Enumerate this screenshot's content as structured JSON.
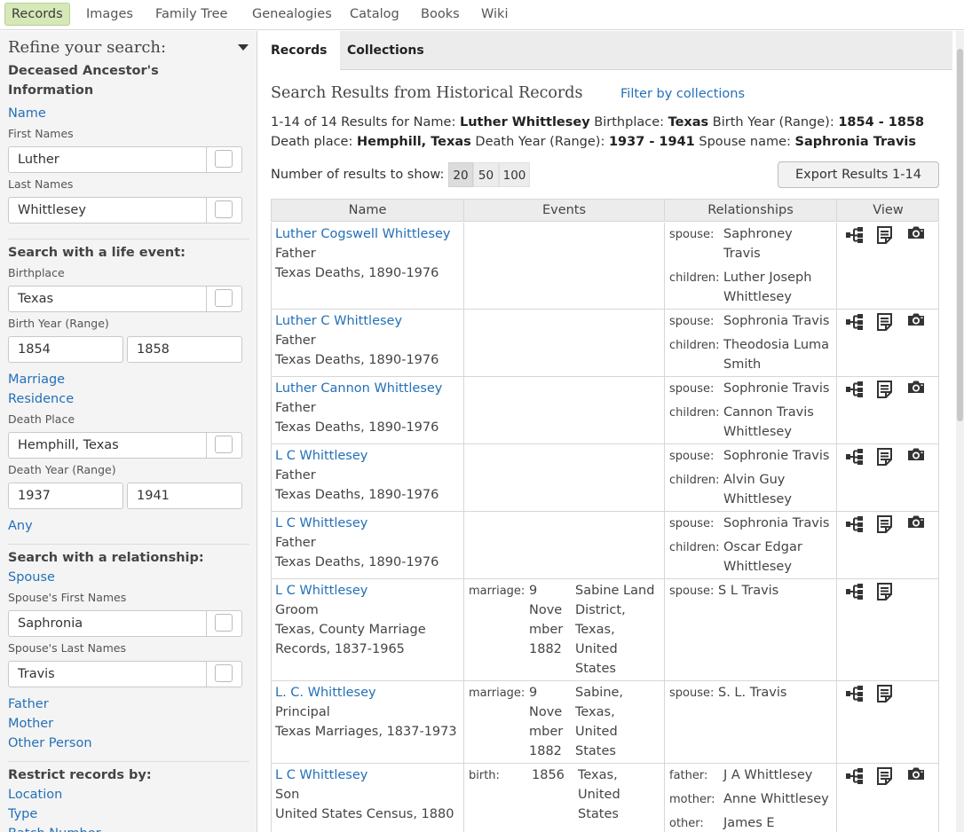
{
  "nav": [
    {
      "label": "Records",
      "active": true
    },
    {
      "label": "Images"
    },
    {
      "label": "Family Tree"
    },
    {
      "label": "Genealogies"
    },
    {
      "label": "Catalog"
    },
    {
      "label": "Books"
    },
    {
      "label": "Wiki"
    }
  ],
  "sidebar": {
    "title": "Refine your search:",
    "deceased_head_1": "Deceased Ancestor's",
    "deceased_head_2": "Information",
    "name_link": "Name",
    "first_names_label": "First Names",
    "first_names_value": "Luther",
    "last_names_label": "Last Names",
    "last_names_value": "Whittlesey",
    "life_event_head": "Search with a life event:",
    "birthplace_label": "Birthplace",
    "birthplace_value": "Texas",
    "birth_year_label": "Birth Year (Range)",
    "birth_year_from": "1854",
    "birth_year_to": "1858",
    "marriage_link": "Marriage",
    "residence_link": "Residence",
    "death_place_label": "Death Place",
    "death_place_value": "Hemphill, Texas",
    "death_year_label": "Death Year (Range)",
    "death_year_from": "1937",
    "death_year_to": "1941",
    "any_link": "Any",
    "relationship_head": "Search with a relationship:",
    "spouse_link": "Spouse",
    "spouse_first_label": "Spouse's First Names",
    "spouse_first_value": "Saphronia",
    "spouse_last_label": "Spouse's Last Names",
    "spouse_last_value": "Travis",
    "father_link": "Father",
    "mother_link": "Mother",
    "other_person_link": "Other Person",
    "restrict_head": "Restrict records by:",
    "location_link": "Location",
    "type_link": "Type",
    "batch_link": "Batch Number"
  },
  "tabs": [
    "Records",
    "Collections"
  ],
  "results": {
    "title": "Search Results from Historical Records",
    "filter_link": "Filter by collections",
    "summary_line1": [
      {
        "t": "1-14 of 14 Results for Name: "
      },
      {
        "t": "Luther Whittlesey",
        "b": true
      },
      {
        "t": " Birthplace: "
      },
      {
        "t": "Texas",
        "b": true
      },
      {
        "t": " Birth Year (Range): "
      },
      {
        "t": "1854 - 1858",
        "b": true
      }
    ],
    "summary_line2": [
      {
        "t": "Death place: "
      },
      {
        "t": "Hemphill, Texas",
        "b": true
      },
      {
        "t": " Death Year (Range): "
      },
      {
        "t": "1937 - 1941",
        "b": true
      },
      {
        "t": " Spouse name: "
      },
      {
        "t": "Saphronia Travis",
        "b": true
      }
    ],
    "show_label": "Number of results to show:",
    "show_options": [
      "20",
      "50",
      "100"
    ],
    "show_selected": "20",
    "export_label": "Export Results 1-14"
  },
  "table": {
    "headers": [
      "Name",
      "Events",
      "Relationships",
      "View"
    ],
    "rows": [
      {
        "name": "Luther Cogswell Whittlesey",
        "role": "Father",
        "collection": [
          "Texas Deaths, 1890-1976"
        ],
        "events": [],
        "rels": [
          {
            "label": "spouse:",
            "lines": [
              "Saphroney",
              "Travis"
            ]
          },
          {
            "label": "children:",
            "lines": [
              "Luther Joseph",
              "Whittlesey"
            ]
          }
        ],
        "camera": true
      },
      {
        "name": "Luther C Whittlesey",
        "role": "Father",
        "collection": [
          "Texas Deaths, 1890-1976"
        ],
        "events": [],
        "rels": [
          {
            "label": "spouse:",
            "lines": [
              "Sophronia Travis"
            ]
          },
          {
            "label": "children:",
            "lines": [
              "Theodosia Luma",
              "Smith"
            ]
          }
        ],
        "camera": true
      },
      {
        "name": "Luther Cannon Whittlesey",
        "role": "Father",
        "collection": [
          "Texas Deaths, 1890-1976"
        ],
        "events": [],
        "rels": [
          {
            "label": "spouse:",
            "lines": [
              "Sophronie Travis"
            ]
          },
          {
            "label": "children:",
            "lines": [
              "Cannon Travis",
              "Whittlesey"
            ]
          }
        ],
        "camera": true
      },
      {
        "name": "L C Whittlesey",
        "role": "Father",
        "collection": [
          "Texas Deaths, 1890-1976"
        ],
        "events": [],
        "rels": [
          {
            "label": "spouse:",
            "lines": [
              "Sophronie Travis"
            ]
          },
          {
            "label": "children:",
            "lines": [
              "Alvin Guy",
              "Whittlesey"
            ]
          }
        ],
        "camera": true
      },
      {
        "name": "L C Whittlesey",
        "role": "Father",
        "collection": [
          "Texas Deaths, 1890-1976"
        ],
        "events": [],
        "rels": [
          {
            "label": "spouse:",
            "lines": [
              "Sophronia Travis"
            ]
          },
          {
            "label": "children:",
            "lines": [
              "Oscar Edgar",
              "Whittlesey"
            ]
          }
        ],
        "camera": true
      },
      {
        "name": "L C Whittlesey",
        "role": "Groom",
        "collection": [
          "Texas, County Marriage",
          "Records, 1837-1965"
        ],
        "events": [
          {
            "label": "marriage:",
            "date": [
              "9",
              "Nove",
              "mber",
              "1882"
            ],
            "place": [
              "Sabine Land",
              "District,",
              "Texas,",
              "United",
              "States"
            ]
          }
        ],
        "rels": [
          {
            "label": "spouse:",
            "lines": [
              "S L Travis"
            ]
          }
        ],
        "camera": false
      },
      {
        "name": "L. C. Whittlesey",
        "role": "Principal",
        "collection": [
          "Texas Marriages, 1837-1973"
        ],
        "events": [
          {
            "label": "marriage:",
            "date": [
              "9",
              "Nove",
              "mber",
              "1882"
            ],
            "place": [
              "Sabine,",
              "Texas,",
              "United",
              "States"
            ]
          }
        ],
        "rels": [
          {
            "label": "spouse:",
            "lines": [
              "S. L. Travis"
            ]
          }
        ],
        "camera": false
      },
      {
        "name": "L C Whittlesey",
        "role": "Son",
        "collection": [
          "United States Census, 1880"
        ],
        "events": [
          {
            "label": "birth:",
            "date": [
              "1856"
            ],
            "place": [
              "Texas,",
              "United",
              "States"
            ]
          }
        ],
        "rels": [
          {
            "label": "father:",
            "lines": [
              "J A Whittlesey"
            ]
          },
          {
            "label": "mother:",
            "lines": [
              "Anne Whittlesey"
            ]
          },
          {
            "label": "other:",
            "lines": [
              "James E"
            ]
          }
        ],
        "camera": true
      }
    ]
  },
  "icons": {
    "tree": "tree-icon",
    "document": "document-icon",
    "camera": "camera-icon"
  }
}
